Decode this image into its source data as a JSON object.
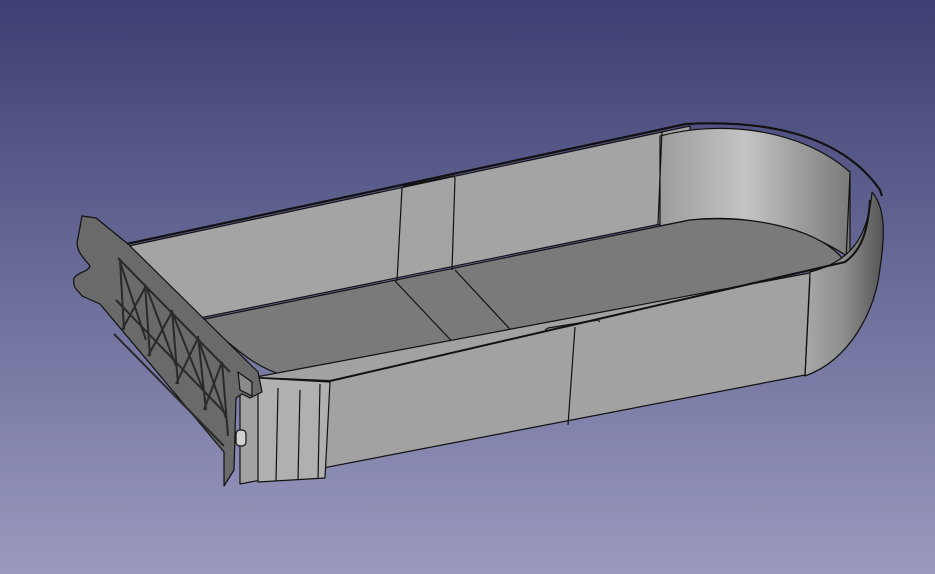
{
  "viewport": {
    "background_top": "#3d3f72",
    "background_bottom": "#9a9ac0"
  },
  "model": {
    "name": "cable-tray-with-bracket",
    "part_color": "#a6a6a6",
    "edge_color": "#111111"
  }
}
